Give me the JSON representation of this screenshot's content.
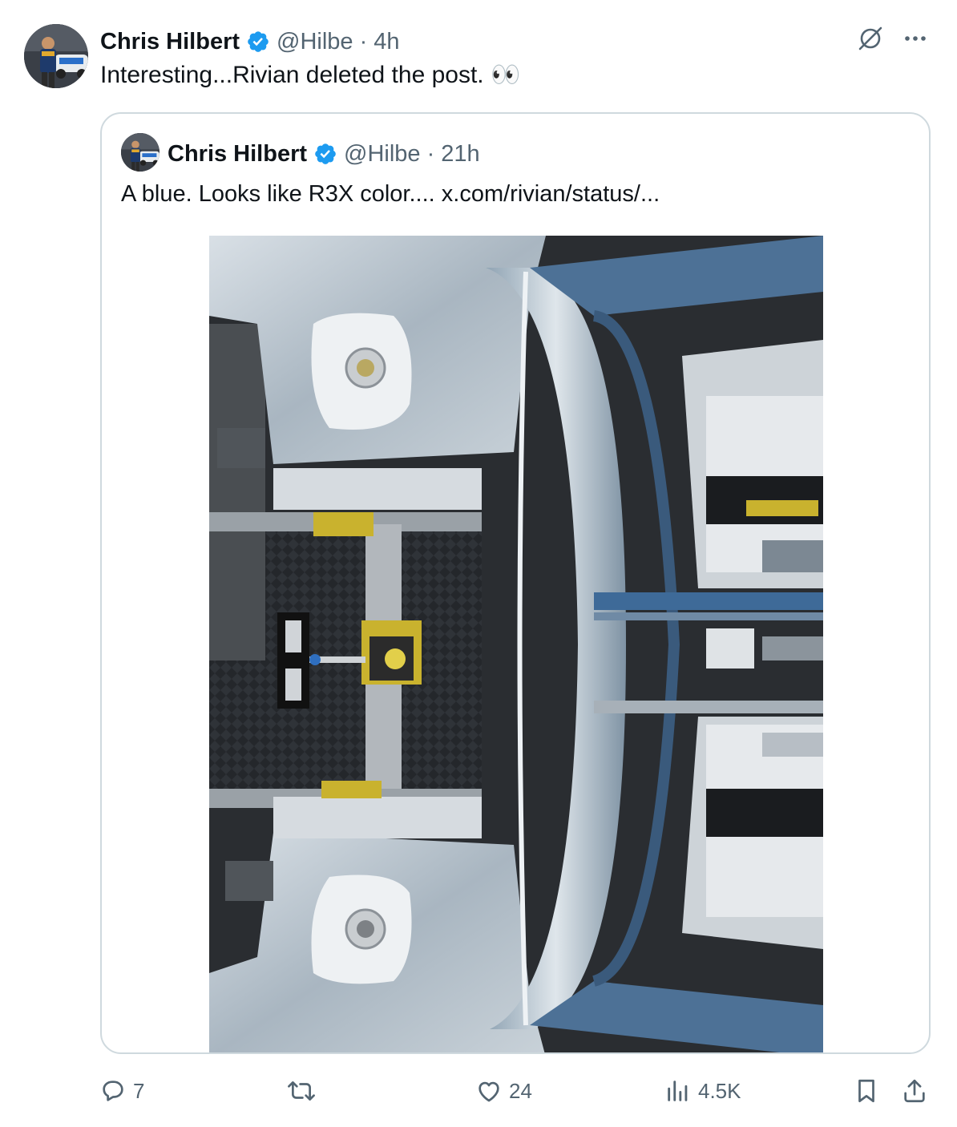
{
  "tweet": {
    "author_name": "Chris Hilbert",
    "handle": "@Hilbe",
    "separator": "·",
    "time": "4h",
    "text": "Interesting...Rivian deleted the post. 👀"
  },
  "quoted_tweet": {
    "author_name": "Chris Hilbert",
    "handle": "@Hilbe",
    "separator": "·",
    "time": "21h",
    "text": "A blue.  Looks like R3X color....  x.com/rivian/status/..."
  },
  "actions": {
    "replies": "7",
    "likes": "24",
    "views": "4.5K"
  },
  "icons": {
    "verified": "verified-badge-icon",
    "grok": "grok-icon",
    "more": "more-icon",
    "reply": "reply-icon",
    "repost": "repost-icon",
    "like": "like-icon",
    "views": "views-icon",
    "bookmark": "bookmark-icon",
    "share": "share-icon"
  },
  "colors": {
    "verified_blue": "#1d9bf0",
    "muted_text": "#536471",
    "border": "#cfd9de",
    "text": "#0f1419"
  }
}
